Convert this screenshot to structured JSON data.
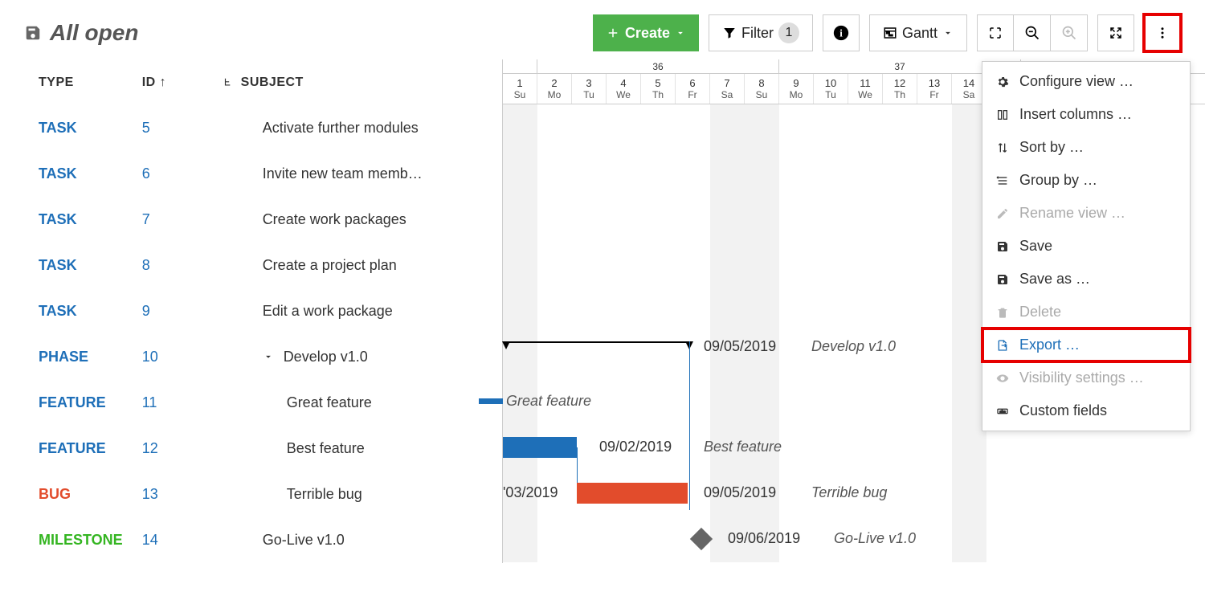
{
  "view": {
    "title": "All open"
  },
  "toolbar": {
    "create_label": "Create",
    "filter_label": "Filter",
    "filter_count": "1",
    "view_mode_label": "Gantt"
  },
  "columns": {
    "type": "TYPE",
    "id": "ID",
    "subject": "SUBJECT"
  },
  "rows": [
    {
      "type": "TASK",
      "type_class": "type-task",
      "id": "5",
      "subject": "Activate further modules",
      "indent": 0,
      "expander": false
    },
    {
      "type": "TASK",
      "type_class": "type-task",
      "id": "6",
      "subject": "Invite new team memb…",
      "indent": 0,
      "expander": false
    },
    {
      "type": "TASK",
      "type_class": "type-task",
      "id": "7",
      "subject": "Create work packages",
      "indent": 0,
      "expander": false
    },
    {
      "type": "TASK",
      "type_class": "type-task",
      "id": "8",
      "subject": "Create a project plan",
      "indent": 0,
      "expander": false
    },
    {
      "type": "TASK",
      "type_class": "type-task",
      "id": "9",
      "subject": "Edit a work package",
      "indent": 0,
      "expander": false
    },
    {
      "type": "PHASE",
      "type_class": "type-phase",
      "id": "10",
      "subject": "Develop v1.0",
      "indent": 0,
      "expander": true
    },
    {
      "type": "FEATURE",
      "type_class": "type-feature",
      "id": "11",
      "subject": "Great feature",
      "indent": 1,
      "expander": false
    },
    {
      "type": "FEATURE",
      "type_class": "type-feature",
      "id": "12",
      "subject": "Best feature",
      "indent": 1,
      "expander": false
    },
    {
      "type": "BUG",
      "type_class": "type-bug",
      "id": "13",
      "subject": "Terrible bug",
      "indent": 1,
      "expander": false
    },
    {
      "type": "MILESTONE",
      "type_class": "type-milestone",
      "id": "14",
      "subject": "Go-Live v1.0",
      "indent": 0,
      "expander": false
    }
  ],
  "gantt": {
    "weeks": [
      "36",
      "37"
    ],
    "days": [
      {
        "n": "1",
        "d": "Su"
      },
      {
        "n": "2",
        "d": "Mo"
      },
      {
        "n": "3",
        "d": "Tu"
      },
      {
        "n": "4",
        "d": "We"
      },
      {
        "n": "5",
        "d": "Th"
      },
      {
        "n": "6",
        "d": "Fr"
      },
      {
        "n": "7",
        "d": "Sa"
      },
      {
        "n": "8",
        "d": "Su"
      },
      {
        "n": "9",
        "d": "Mo"
      },
      {
        "n": "10",
        "d": "Tu"
      },
      {
        "n": "11",
        "d": "We"
      },
      {
        "n": "12",
        "d": "Th"
      },
      {
        "n": "13",
        "d": "Fr"
      },
      {
        "n": "14",
        "d": "Sa"
      }
    ],
    "phase": {
      "date": "09/05/2019",
      "label": "Develop v1.0"
    },
    "feat1": {
      "label": "Great feature"
    },
    "feat2": {
      "date": "09/02/2019",
      "label": "Best feature"
    },
    "bug": {
      "date_left": "'03/2019",
      "date": "09/05/2019",
      "label": "Terrible bug"
    },
    "ms": {
      "date": "09/06/2019",
      "label": "Go-Live v1.0"
    }
  },
  "menu": {
    "configure": "Configure view …",
    "insert_cols": "Insert columns …",
    "sort_by": "Sort by …",
    "group_by": "Group by …",
    "rename": "Rename view …",
    "save": "Save",
    "save_as": "Save as …",
    "delete": "Delete",
    "export": "Export …",
    "visibility": "Visibility settings …",
    "custom_fields": "Custom fields"
  }
}
